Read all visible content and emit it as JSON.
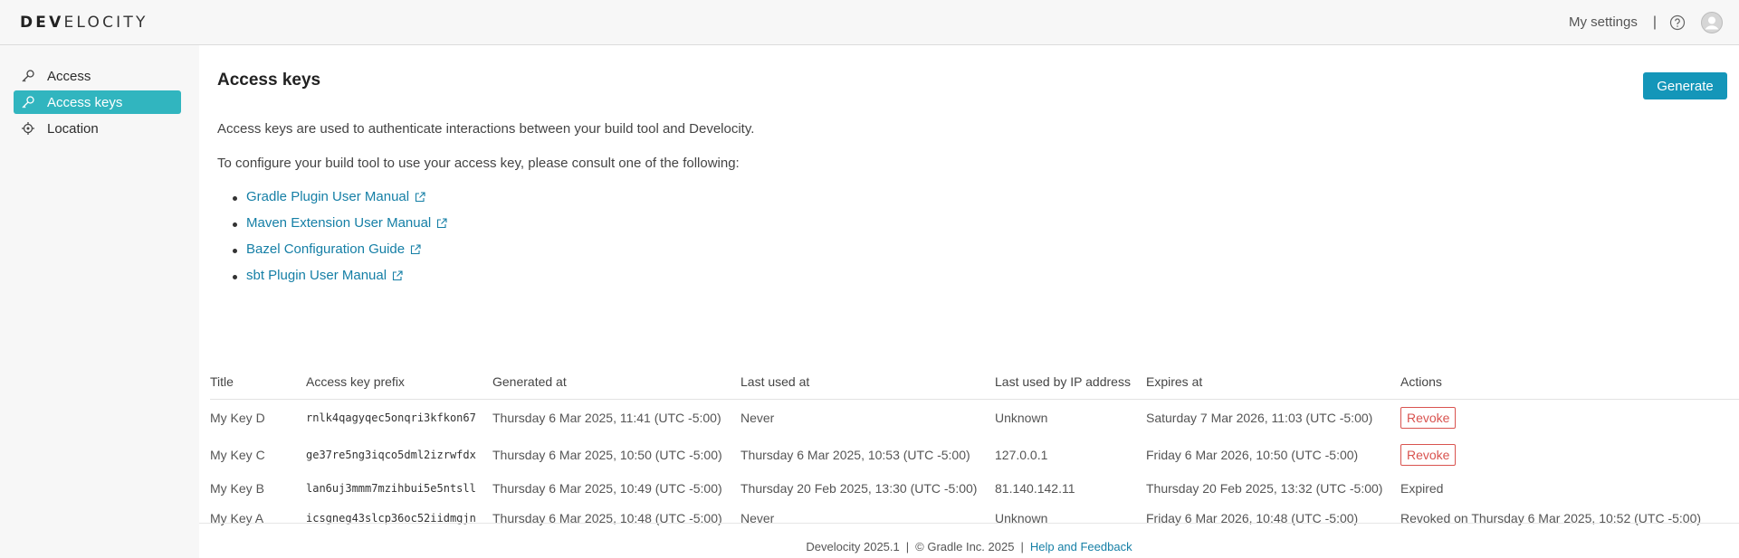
{
  "header": {
    "logo_bold": "DEV",
    "logo_rest": "ELOCITY",
    "my_settings": "My settings",
    "separator": "|"
  },
  "sidebar": {
    "items": [
      {
        "label": "Access",
        "icon": "key-icon"
      },
      {
        "label": "Access keys",
        "icon": "key-icon",
        "active": true
      },
      {
        "label": "Location",
        "icon": "location-icon"
      }
    ]
  },
  "main": {
    "title": "Access keys",
    "generate_label": "Generate",
    "intro": "Access keys are used to authenticate interactions between your build tool and Develocity.",
    "configure": "To configure your build tool to use your access key, please consult one of the following:",
    "links": [
      "Gradle Plugin User Manual",
      "Maven Extension User Manual",
      "Bazel Configuration Guide",
      "sbt Plugin User Manual"
    ]
  },
  "table": {
    "headers": [
      "Title",
      "Access key prefix",
      "Generated at",
      "Last used at",
      "Last used by IP address",
      "Expires at",
      "Actions"
    ],
    "rows": [
      {
        "title": "My Key D",
        "prefix": "rnlk4qagyqec5onqri3kfkon67",
        "generated": "Thursday 6 Mar 2025, 11:41 (UTC -5:00)",
        "last_used": "Never",
        "ip": "Unknown",
        "expires": "Saturday 7 Mar 2026, 11:03 (UTC -5:00)",
        "action": "Revoke"
      },
      {
        "title": "My Key C",
        "prefix": "ge37re5ng3iqco5dml2izrwfdx",
        "generated": "Thursday 6 Mar 2025, 10:50 (UTC -5:00)",
        "last_used": "Thursday 6 Mar 2025, 10:53 (UTC -5:00)",
        "ip": "127.0.0.1",
        "expires": "Friday 6 Mar 2026, 10:50 (UTC -5:00)",
        "action": "Revoke"
      },
      {
        "title": "My Key B",
        "prefix": "lan6uj3mmm7mzihbui5e5ntsll",
        "generated": "Thursday 6 Mar 2025, 10:49 (UTC -5:00)",
        "last_used": "Thursday 20 Feb 2025, 13:30 (UTC -5:00)",
        "ip": "81.140.142.11",
        "expires": "Thursday 20 Feb 2025, 13:32 (UTC -5:00)",
        "action": "Expired"
      },
      {
        "title": "My Key A",
        "prefix": "icsgneg43slcp36oc52iidmgjn",
        "generated": "Thursday 6 Mar 2025, 10:48 (UTC -5:00)",
        "last_used": "Never",
        "ip": "Unknown",
        "expires": "Friday 6 Mar 2026, 10:48 (UTC -5:00)",
        "action": "Revoked on Thursday 6 Mar 2025, 10:52 (UTC -5:00)"
      }
    ]
  },
  "footer": {
    "version": "Develocity 2025.1",
    "separator": "|",
    "copyright": "© Gradle Inc. 2025",
    "help": "Help and Feedback"
  },
  "colors": {
    "accent": "#31b5bf",
    "primary_button": "#1496b9",
    "link": "#157fa6",
    "danger": "#d9534f"
  }
}
